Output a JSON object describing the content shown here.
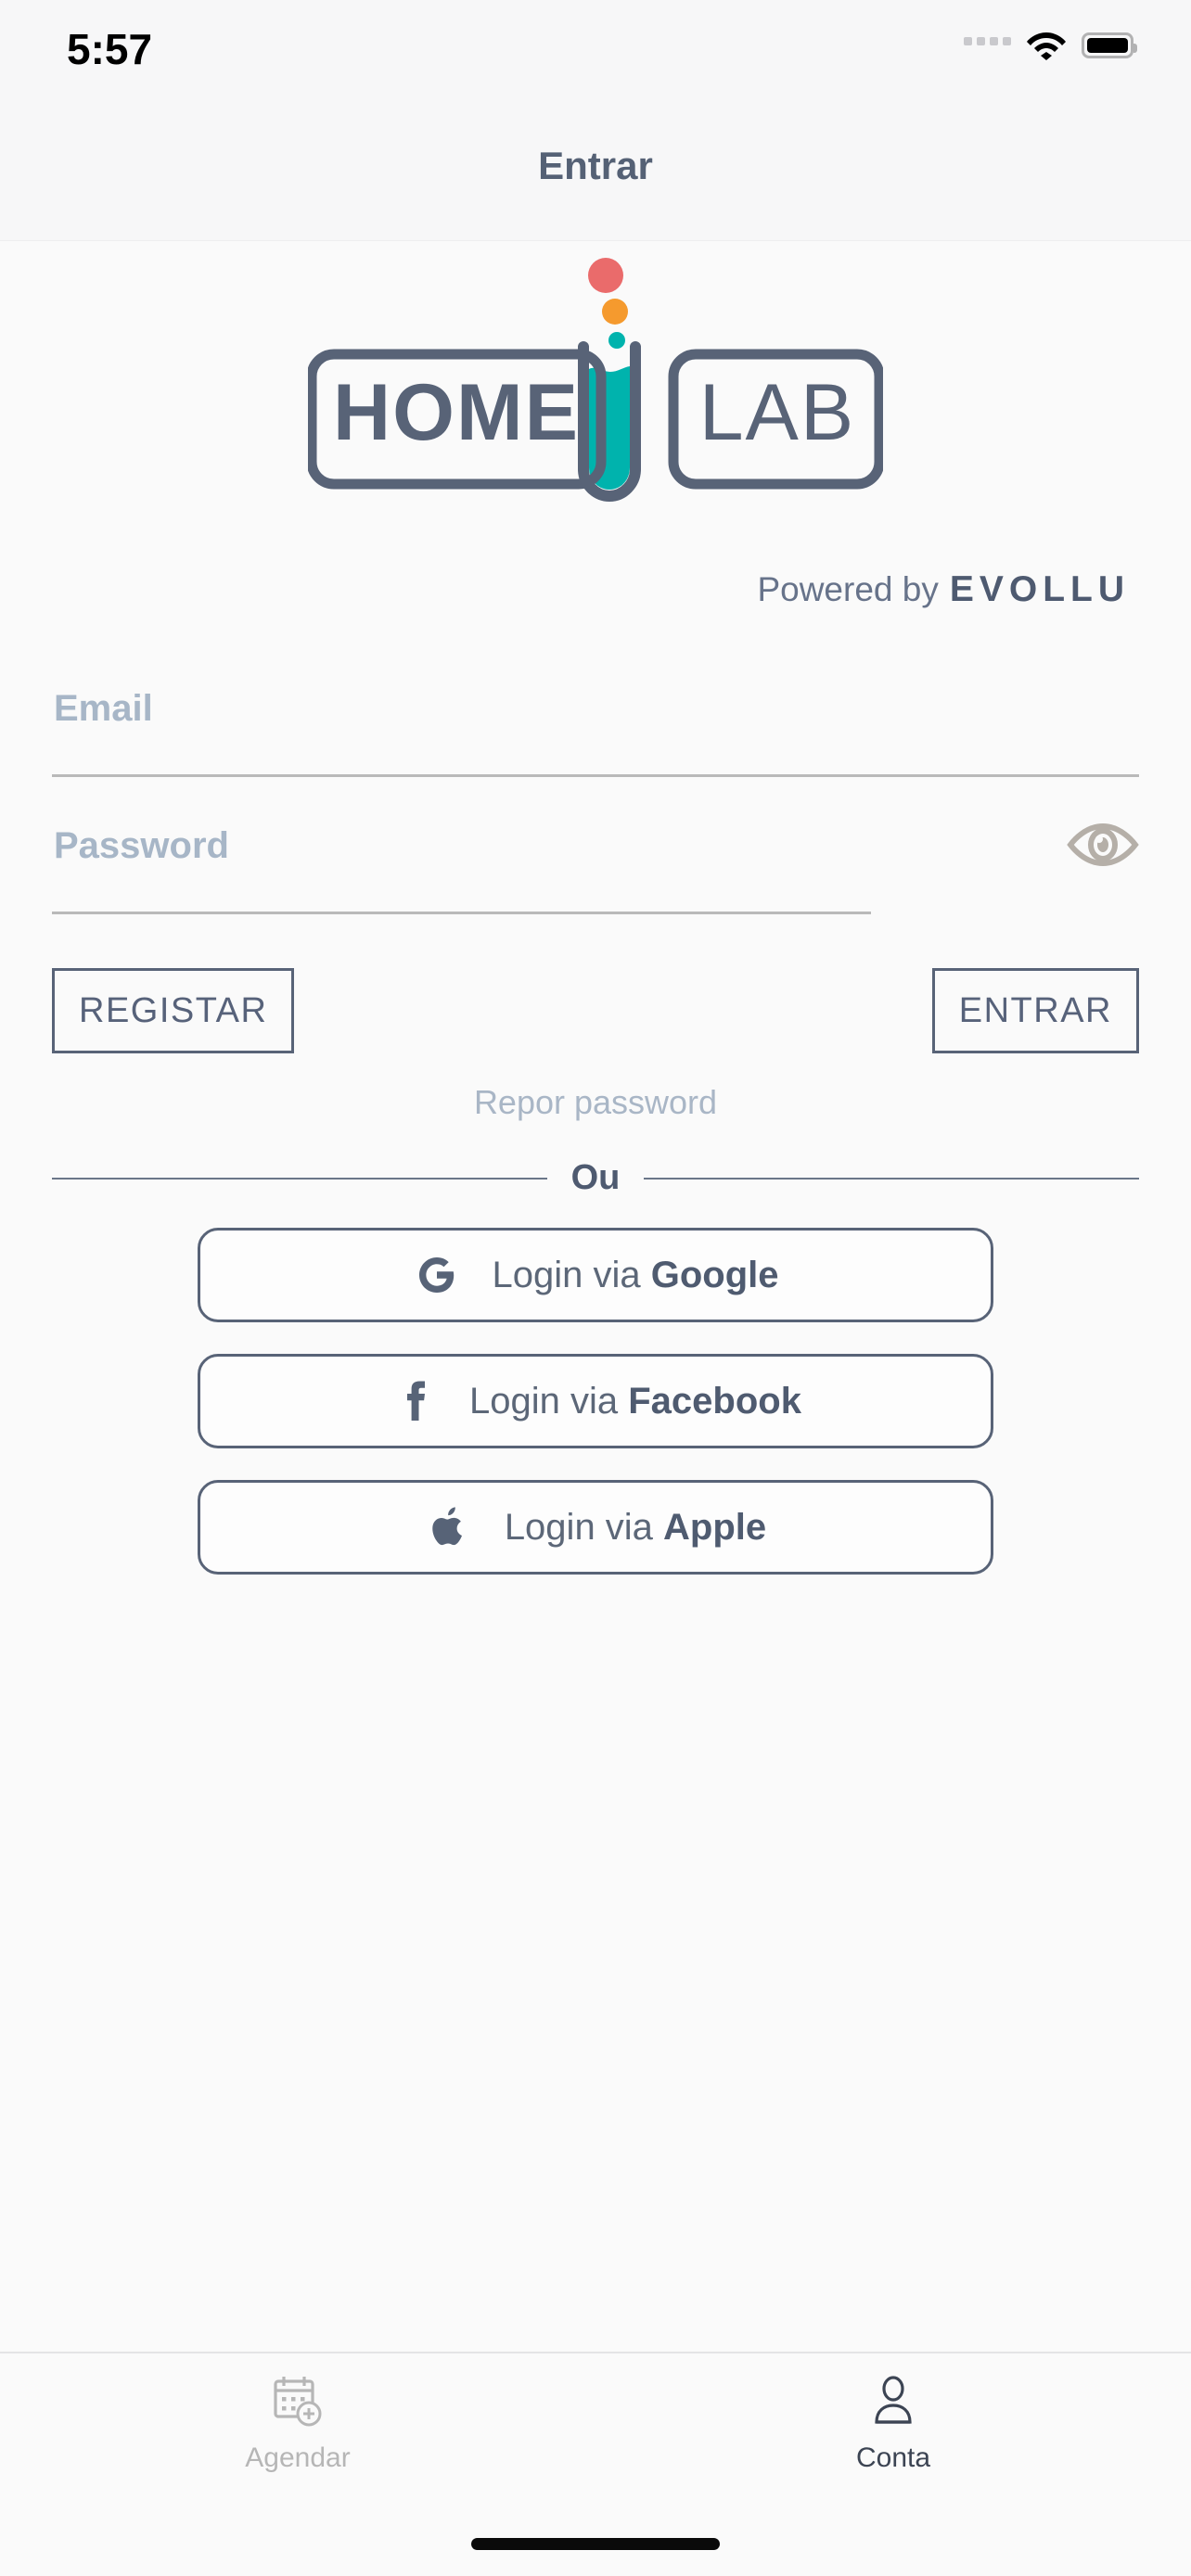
{
  "status_bar": {
    "time": "5:57",
    "icons": [
      "signal-dots-icon",
      "wifi-icon",
      "battery-full-icon"
    ]
  },
  "header": {
    "title": "Entrar"
  },
  "logo": {
    "word_left": "HOME",
    "word_right": "LAB",
    "icon_name": "homelab-test-tube-logo",
    "colors": {
      "outline": "#586377",
      "liquid": "#00b3ad",
      "drop_red": "#ea6b6b",
      "drop_orange": "#f59a2e",
      "drop_teal": "#00b3ad"
    }
  },
  "powered_by": {
    "prefix": "Powered by",
    "brand": "EVOLLU"
  },
  "form": {
    "email": {
      "label": "Email",
      "placeholder": "Email",
      "value": ""
    },
    "password": {
      "label": "Password",
      "placeholder": "Password",
      "value": "",
      "toggle_icon": "eye-icon"
    }
  },
  "actions": {
    "register_label": "REGISTAR",
    "login_label": "ENTRAR",
    "reset_password_label": "Repor password"
  },
  "divider": {
    "label": "Ou"
  },
  "social_logins": [
    {
      "icon": "google-icon",
      "prefix": "Login via ",
      "provider": "Google"
    },
    {
      "icon": "facebook-icon",
      "prefix": "Login via ",
      "provider": "Facebook"
    },
    {
      "icon": "apple-icon",
      "prefix": "Login via ",
      "provider": "Apple"
    }
  ],
  "tab_bar": {
    "items": [
      {
        "icon": "calendar-plus-icon",
        "label": "Agendar",
        "active": false
      },
      {
        "icon": "person-icon",
        "label": "Conta",
        "active": true
      }
    ]
  },
  "theme": {
    "background": "#fafafa",
    "slate": "#586377",
    "muted": "#a7b6c7",
    "teal": "#00b3ad"
  }
}
